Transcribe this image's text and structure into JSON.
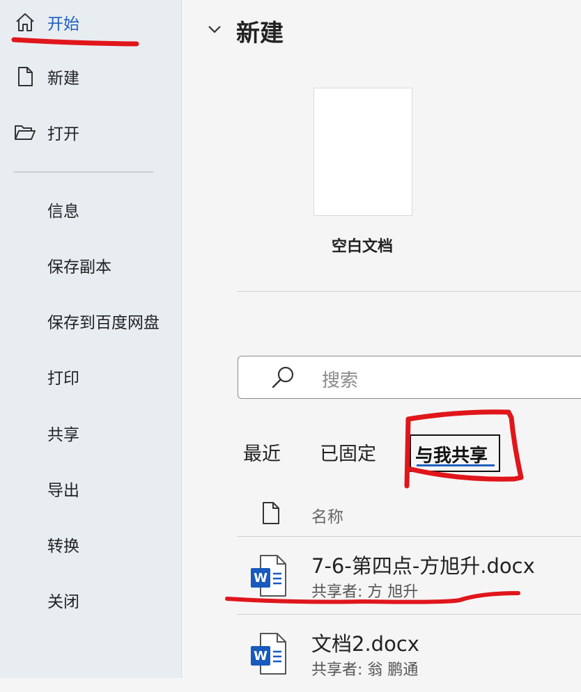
{
  "sidebar": {
    "items": [
      {
        "label": "开始",
        "icon": "home-icon"
      },
      {
        "label": "新建",
        "icon": "new-document-icon"
      },
      {
        "label": "打开",
        "icon": "folder-open-icon"
      },
      {
        "label": "信息"
      },
      {
        "label": "保存副本"
      },
      {
        "label": "保存到百度网盘"
      },
      {
        "label": "打印"
      },
      {
        "label": "共享"
      },
      {
        "label": "导出"
      },
      {
        "label": "转换"
      },
      {
        "label": "关闭"
      }
    ]
  },
  "main": {
    "section_title": "新建",
    "templates": [
      {
        "label": "空白文档"
      }
    ],
    "search": {
      "placeholder": "搜索"
    },
    "tabs": [
      {
        "label": "最近"
      },
      {
        "label": "已固定"
      },
      {
        "label": "与我共享"
      }
    ],
    "columns": {
      "name": "名称"
    },
    "files": [
      {
        "name": "7-6-第四点-方旭升.docx",
        "sharer": "共享者: 方 旭升",
        "icon": "word-document-icon"
      },
      {
        "name": "文档2.docx",
        "sharer": "共享者: 翁 鹏通",
        "icon": "word-document-icon"
      }
    ]
  },
  "colors": {
    "accent": "#1f5fbf",
    "annotation": "#e0161b",
    "sidebar_bg": "#e8edf2",
    "word_blue": "#185abd"
  }
}
